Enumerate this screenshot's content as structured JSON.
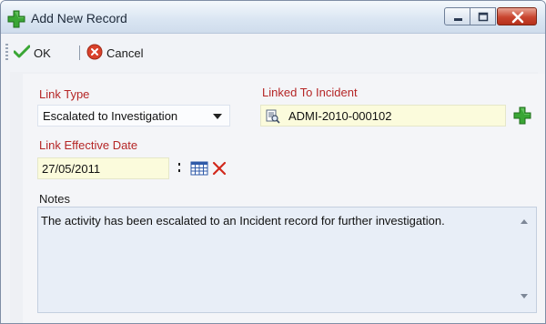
{
  "window": {
    "title": "Add New Record"
  },
  "toolbar": {
    "ok_label": "OK",
    "cancel_label": "Cancel"
  },
  "form": {
    "link_type": {
      "label": "Link Type",
      "value": "Escalated to Investigation"
    },
    "linked_to_incident": {
      "label": "Linked To Incident",
      "value": "ADMI-2010-000102"
    },
    "link_effective_date": {
      "label": "Link Effective Date",
      "value": "27/05/2011"
    },
    "notes": {
      "label": "Notes",
      "value": "The activity has been escalated to an Incident record for further investigation."
    }
  },
  "icons": {
    "title": "green-plus-icon",
    "ok": "checkmark-icon",
    "cancel": "red-x-circle-icon",
    "lookup": "lookup-icon",
    "add": "green-plus-icon",
    "calendar": "calendar-icon",
    "clear": "red-x-icon"
  },
  "colors": {
    "required_label": "#b52626",
    "accent_green": "#3aa635",
    "field_highlight": "#fbfbdc"
  }
}
